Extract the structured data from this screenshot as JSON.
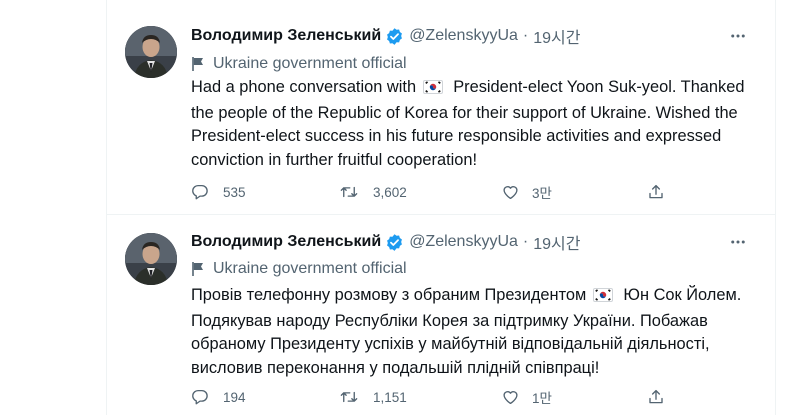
{
  "colors": {
    "verified": "#1d9bf0",
    "secondary_text": "#536471",
    "primary_text": "#0f1419",
    "divider": "#eff3f4"
  },
  "tweets": [
    {
      "author_name": "Володимир Зеленський",
      "handle": "@ZelenskyyUa",
      "separator": "·",
      "time": "19시간",
      "account_label": "Ukraine government official",
      "text_before_flag": "Had a phone conversation with",
      "flag_icon": "south-korea-flag-emoji",
      "text_after_flag": "President-elect Yoon Suk-yeol. Thanked the people of the Republic of Korea for their support of Ukraine. Wished the President-elect success in his future responsible activities and expressed conviction in further fruitful cooperation!",
      "replies": "535",
      "retweets": "3,602",
      "likes": "3만"
    },
    {
      "author_name": "Володимир Зеленський",
      "handle": "@ZelenskyyUa",
      "separator": "·",
      "time": "19시간",
      "account_label": "Ukraine government official",
      "text_before_flag": "Провів телефонну розмову з обраним Президентом",
      "flag_icon": "south-korea-flag-emoji",
      "text_after_flag": "Юн Сок Йолем. Подякував народу Республіки Корея за підтримку України. Побажав обраному Президенту успіхів у майбутній відповідальній діяльності, висловив переконання у подальшій плідній співпраці!",
      "replies": "194",
      "retweets": "1,151",
      "likes": "1만"
    }
  ]
}
